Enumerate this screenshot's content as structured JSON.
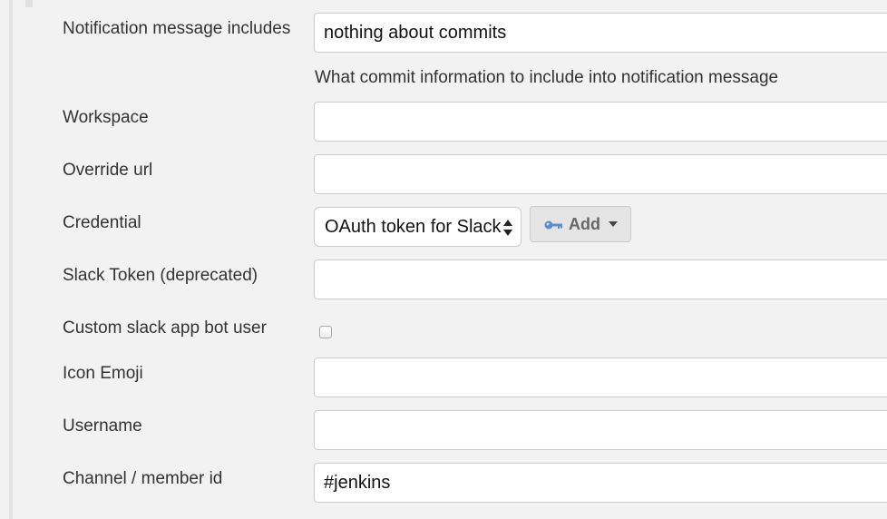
{
  "form": {
    "notification_message": {
      "label": "Notification message includes",
      "value": "nothing about commits",
      "help": "What commit information to include into notification message"
    },
    "workspace": {
      "label": "Workspace",
      "value": ""
    },
    "override_url": {
      "label": "Override url",
      "value": ""
    },
    "credential": {
      "label": "Credential",
      "selected": "OAuth token for Slack",
      "add_label": "Add"
    },
    "slack_token": {
      "label": "Slack Token (deprecated)",
      "value": ""
    },
    "custom_bot_user": {
      "label": "Custom slack app bot user",
      "checked": false
    },
    "icon_emoji": {
      "label": "Icon Emoji",
      "value": ""
    },
    "username": {
      "label": "Username",
      "value": ""
    },
    "channel": {
      "label": "Channel / member id",
      "value": "#jenkins"
    }
  },
  "icons": {
    "key": "key-icon",
    "caret": "caret-down-icon",
    "select_arrows": "select-arrows-icon"
  },
  "colors": {
    "background": "#f2f2f2",
    "input_border": "#cccccc",
    "key_icon": "#5b8fc7"
  }
}
